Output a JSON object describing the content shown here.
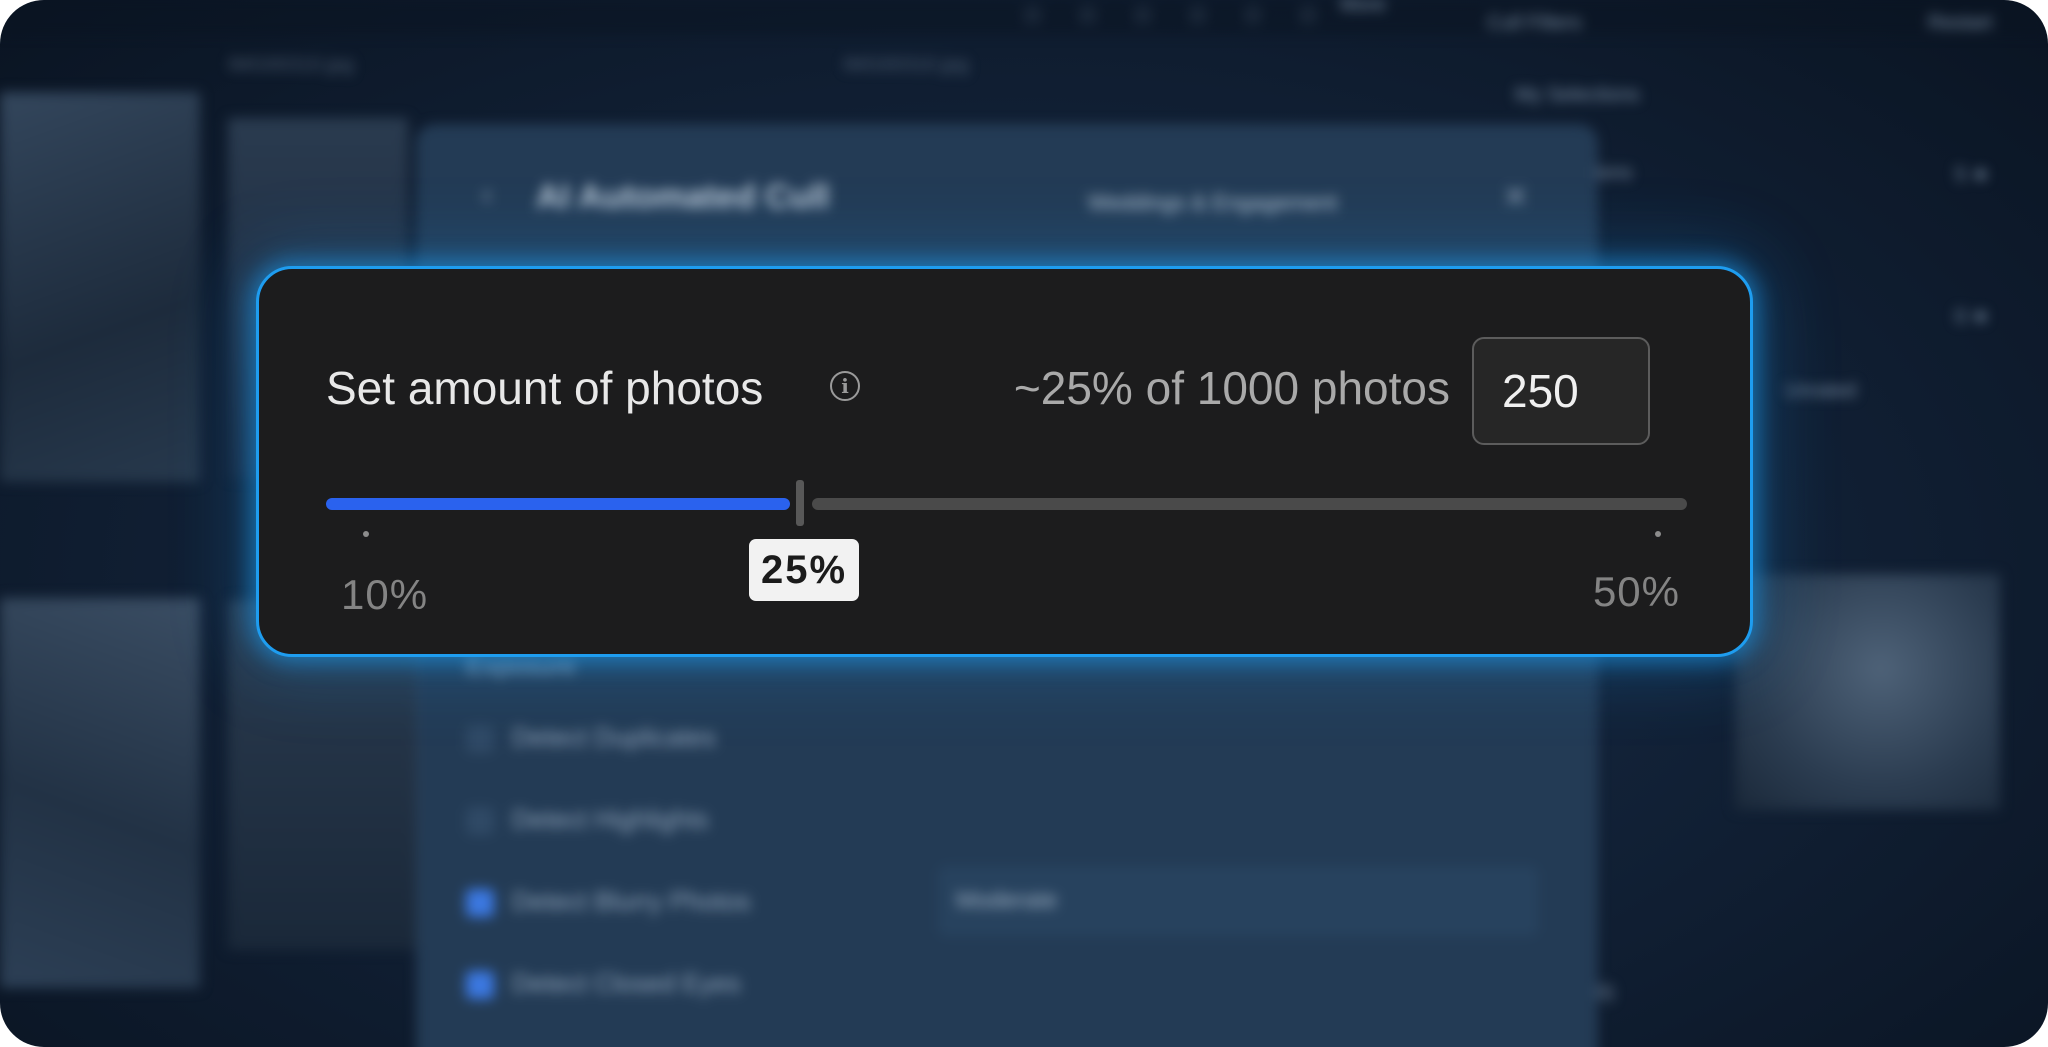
{
  "background": {
    "filenames": [
      "IMG00310.jpg",
      "IMG00310.jpg"
    ],
    "more_label": "More",
    "cull_filters_label": "Cull Filters",
    "restart_label": "Restart",
    "my_selections_label": "My Selections",
    "collections_label": "ctions",
    "unrated_label": "Unrated",
    "rating_counts": [
      "5 ★",
      "0 ★"
    ],
    "footer_count": "(0)",
    "modal": {
      "title": "AI Automated Cull",
      "preset": "Weddings & Engagement",
      "section": "Exposure",
      "options": [
        {
          "label": "Detect Duplicates",
          "checked": false
        },
        {
          "label": "Detect Highlights",
          "checked": false
        },
        {
          "label": "Detect Blurry Photos",
          "checked": true
        },
        {
          "label": "Detect Closed Eyes",
          "checked": true
        }
      ],
      "blur_level": "Moderate"
    }
  },
  "slider_card": {
    "label": "Set amount of photos",
    "info_icon": "info-icon",
    "summary": "~25% of 1000 photos",
    "count_value": "250",
    "min_label": "10%",
    "max_label": "50%",
    "current_label": "25%",
    "min_percent": 10,
    "max_percent": 50,
    "current_percent": 25,
    "total_photos": 1000,
    "colors": {
      "accent_blue": "#2a62ee",
      "glow": "#1e9df0",
      "card_bg": "#1c1c1d"
    }
  }
}
